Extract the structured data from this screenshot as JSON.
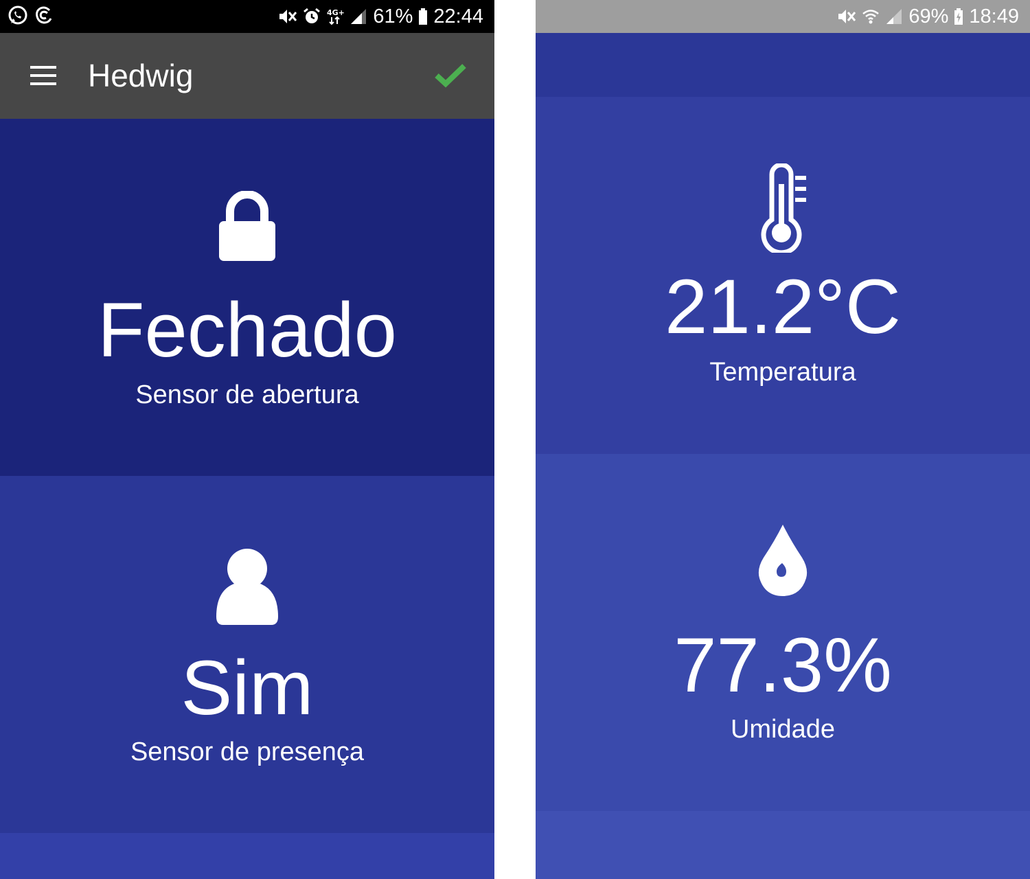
{
  "left_screen": {
    "status_bar": {
      "left_icons": [
        "whatsapp-icon",
        "notification-app-icon"
      ],
      "right_icons": [
        "mute-icon",
        "alarm-icon",
        "network-4g-icon",
        "signal-icon"
      ],
      "battery_percent": "61%",
      "time": "22:44"
    },
    "app_bar": {
      "title": "Hedwig",
      "menu_icon": "hamburger-menu-icon",
      "status_icon": "check-icon",
      "status_color": "#4caf50"
    },
    "tiles": [
      {
        "icon": "lock-icon",
        "value": "Fechado",
        "label": "Sensor de abertura"
      },
      {
        "icon": "person-icon",
        "value": "Sim",
        "label": "Sensor de presença"
      }
    ]
  },
  "right_screen": {
    "status_bar": {
      "right_icons": [
        "mute-icon",
        "wifi-icon",
        "signal-icon"
      ],
      "battery_percent": "69%",
      "time": "18:49"
    },
    "tiles": [
      {
        "icon": "thermometer-icon",
        "value": "21.2°C",
        "label": "Temperatura"
      },
      {
        "icon": "water-drop-icon",
        "value": "77.3%",
        "label": "Umidade"
      }
    ]
  },
  "colors": {
    "appbar": "#474747",
    "tile_dark": "#1b247a",
    "tile_mid": "#2b3797",
    "tile_light": "#3a4aac",
    "accent_check": "#4caf50"
  }
}
